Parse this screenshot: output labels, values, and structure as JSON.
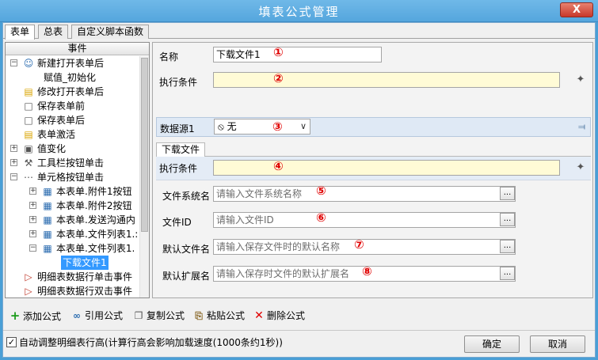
{
  "window": {
    "title": "填表公式管理",
    "close_glyph": "X"
  },
  "tabs": [
    {
      "label": "表单",
      "active": true
    },
    {
      "label": "总表",
      "active": false
    },
    {
      "label": "自定义脚本函数",
      "active": false
    }
  ],
  "tree": {
    "header": "事件",
    "nodes": [
      {
        "label": "新建打开表单后",
        "expander": "−",
        "icon": "person-add-icon"
      },
      {
        "label": "赋值_初始化",
        "expander": "",
        "icon": ""
      },
      {
        "label": "修改打开表单后",
        "expander": "",
        "icon": "folder-icon"
      },
      {
        "label": "保存表单前",
        "expander": "",
        "icon": "doc-icon"
      },
      {
        "label": "保存表单后",
        "expander": "",
        "icon": "doc-icon"
      },
      {
        "label": "表单激活",
        "expander": "",
        "icon": "folder-icon"
      },
      {
        "label": "值变化",
        "expander": "+",
        "icon": "value-icon"
      },
      {
        "label": "工具栏按钮单击",
        "expander": "+",
        "icon": "tool-icon"
      },
      {
        "label": "单元格按钮单击",
        "expander": "−",
        "icon": "dots-icon"
      },
      {
        "label": "本表单.附件1按钮",
        "expander": "+",
        "icon": "table-icon"
      },
      {
        "label": "本表单.附件2按钮",
        "expander": "+",
        "icon": "table-icon"
      },
      {
        "label": "本表单.发送沟通内",
        "expander": "+",
        "icon": "table-icon"
      },
      {
        "label": "本表单.文件列表1.:",
        "expander": "+",
        "icon": "table-icon"
      },
      {
        "label": "本表单.文件列表1.",
        "expander": "−",
        "icon": "table-icon"
      },
      {
        "label": "下载文件1",
        "expander": "",
        "icon": "",
        "selected": true
      },
      {
        "label": "明细表数据行单击事件",
        "expander": "",
        "icon": "flag-icon"
      },
      {
        "label": "明细表数据行双击事件",
        "expander": "",
        "icon": "flag-icon"
      }
    ]
  },
  "form": {
    "name_label": "名称",
    "name_value": "下载文件1",
    "cond_label": "执行条件",
    "cond_value": "",
    "datasource_label": "数据源1",
    "datasource_value": "无",
    "subtab_label": "下载文件",
    "sub_cond_label": "执行条件",
    "sub_cond_value": "",
    "fs_label": "文件系统名",
    "fs_placeholder": "请输入文件系统名称",
    "fileid_label": "文件ID",
    "fileid_placeholder": "请输入文件ID",
    "defname_label": "默认文件名",
    "defname_placeholder": "请输入保存文件时的默认名称",
    "defext_label": "默认扩展名",
    "defext_placeholder": "请输入保存时文件的默认扩展名",
    "ellipsis": "...",
    "markers": [
      "①",
      "②",
      "③",
      "④",
      "⑤",
      "⑥",
      "⑦",
      "⑧"
    ]
  },
  "toolbar": {
    "add": "添加公式",
    "ref": "引用公式",
    "copy": "复制公式",
    "paste": "粘贴公式",
    "delete": "删除公式"
  },
  "bottom": {
    "autofit_label": "自动调整明细表行高(计算行高会影响加载速度(1000条约1秒))",
    "autofit_checked": true,
    "ok": "确定",
    "cancel": "取消"
  },
  "colors": {
    "titlebar": "#5aa9df",
    "selection": "#3399ff",
    "marker": "#e00000",
    "yellow_input": "#fffbd6"
  }
}
